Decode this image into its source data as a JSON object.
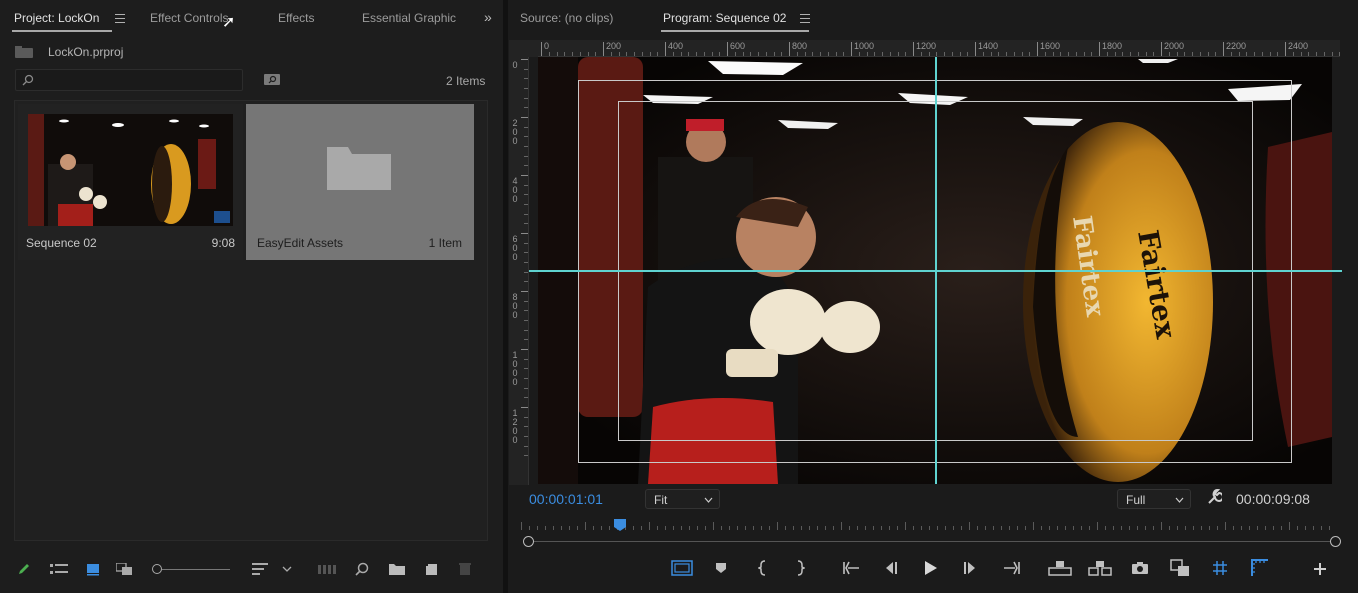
{
  "left_panel": {
    "tabs": [
      {
        "label": "Project: LockOn"
      },
      {
        "label": "Effect Controls"
      },
      {
        "label": "Effects"
      },
      {
        "label": "Essential Graphic"
      }
    ],
    "project_file": "LockOn.prproj",
    "search_placeholder": "",
    "item_count": "2 Items",
    "items": [
      {
        "name": "Sequence 02",
        "meta": "9:08"
      },
      {
        "name": "EasyEdit Assets",
        "meta": "1 Item"
      }
    ]
  },
  "right_panel": {
    "tabs": [
      {
        "label": "Source: (no clips)"
      },
      {
        "label": "Program: Sequence 02"
      }
    ],
    "ruler_h_labels": [
      "0",
      "200",
      "400",
      "600",
      "800",
      "1000",
      "1200",
      "1400",
      "1600",
      "1800",
      "2000",
      "2200",
      "2400"
    ],
    "ruler_v_labels": [
      "0",
      "200",
      "400",
      "600",
      "800",
      "1000",
      "1200"
    ],
    "current_time": "00:00:01:01",
    "fit_value": "Fit",
    "quality_value": "Full",
    "duration": "00:00:09:08",
    "playhead_fraction": 0.113
  },
  "colors": {
    "accent_blue": "#3b8de0",
    "guide_cyan": "#5fd3d0",
    "bag_yellow": "#e5a51c"
  },
  "icons": {
    "left_toolbar": [
      "pencil-icon",
      "list-view-icon",
      "icon-view-icon",
      "freeform-view-icon",
      "zoom-slider",
      "sort-icon",
      "chevron-down-icon",
      "automate-icon",
      "find-icon",
      "new-bin-icon",
      "new-item-icon",
      "trash-icon"
    ],
    "right_toolbar": [
      "safe-margins-icon",
      "marker-icon",
      "mark-in-icon",
      "mark-out-icon",
      "go-to-in-icon",
      "step-back-icon",
      "play-icon",
      "step-forward-icon",
      "go-to-out-icon",
      "lift-icon",
      "extract-icon",
      "export-frame-icon",
      "comparison-view-icon",
      "guides-icon",
      "rulers-icon",
      "add-icon"
    ]
  }
}
